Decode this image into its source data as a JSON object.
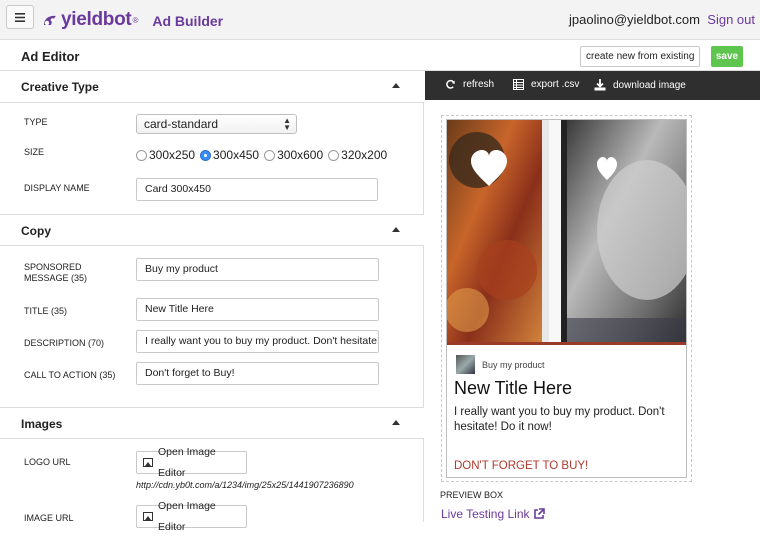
{
  "header": {
    "brand_name": "yieldbot",
    "product_name": "Ad Builder",
    "user_email": "jpaolino@yieldbot.com",
    "sign_out_label": "Sign out",
    "brand_color": "#6a3a9c"
  },
  "editor": {
    "title": "Ad Editor",
    "create_new_label": "create new from existing",
    "save_label": "save"
  },
  "creative_type": {
    "section_title": "Creative Type",
    "type_label": "TYPE",
    "type_value": "card-standard",
    "size_label": "SIZE",
    "sizes": [
      {
        "label": "300x250",
        "selected": false
      },
      {
        "label": "300x450",
        "selected": true
      },
      {
        "label": "300x600",
        "selected": false
      },
      {
        "label": "320x200",
        "selected": false
      }
    ],
    "display_name_label": "DISPLAY NAME",
    "display_name_value": "Card 300x450"
  },
  "copy": {
    "section_title": "Copy",
    "sponsored_label": "SPONSORED MESSAGE (35)",
    "sponsored_value": "Buy my product",
    "title_label": "TITLE (35)",
    "title_value": "New Title Here",
    "description_label": "DESCRIPTION (70)",
    "description_value": "I really want you to buy my product.  Don't hesitate!",
    "cta_label": "CALL TO ACTION (35)",
    "cta_value": "Don't forget to Buy!"
  },
  "images": {
    "section_title": "Images",
    "logo_url_label": "LOGO URL",
    "open_editor_label": "Open Image Editor",
    "logo_url_value": "http://cdn.yb0t.com/a/1234/img/25x25/1441907236890",
    "image_url_label": "IMAGE URL"
  },
  "preview": {
    "toolbar": {
      "refresh_label": "refresh",
      "export_label": "export .csv",
      "download_label": "download image"
    },
    "card": {
      "sponsored": "Buy my product",
      "title": "New Title Here",
      "description": "I really want you to buy my product. Don't hesitate! Do it now!",
      "cta": "DON'T FORGET TO BUY!",
      "cta_color": "#b03a2e"
    },
    "box_label": "PREVIEW BOX",
    "live_link_label": "Live Testing Link"
  }
}
